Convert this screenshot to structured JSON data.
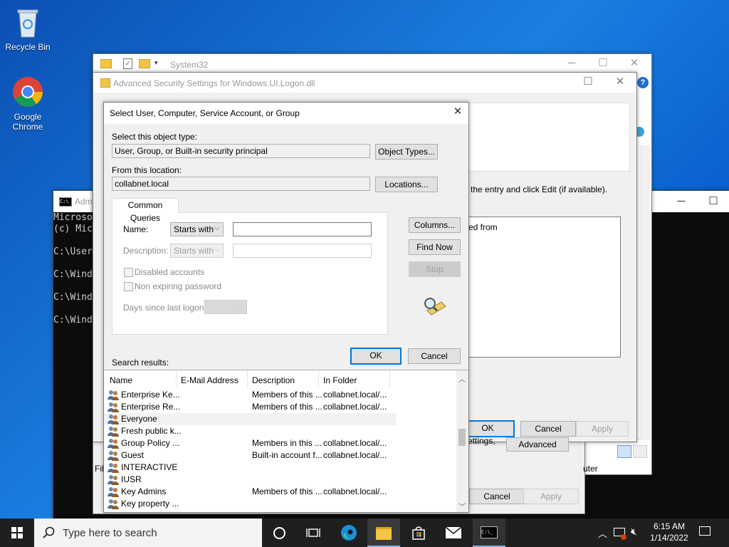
{
  "desktop": {
    "recycle_bin": "Recycle Bin",
    "chrome_line1": "Google",
    "chrome_line2": "Chrome"
  },
  "explorer": {
    "title": "System32"
  },
  "cmd": {
    "title": "Adm",
    "lines": [
      "Microso",
      "(c) Mic",
      "",
      "C:\\User",
      "",
      "C:\\Wind",
      "",
      "C:\\Wind",
      "",
      "C:\\Wind"
    ]
  },
  "adv": {
    "title": "Advanced Security Settings for Windows.UI.Logon.dll",
    "instruction": "the entry and click Edit (if available).",
    "inherited_from": "ed from",
    "settings_fragment": "ettings,",
    "advanced_button": "Advanced",
    "ok": "OK",
    "cancel": "Cancel",
    "apply": "Apply"
  },
  "props": {
    "cancel": "Cancel",
    "apply": "Apply",
    "fil_fragment": "Fil",
    "computer_fragment": "uter"
  },
  "dlg": {
    "title": "Select User, Computer, Service Account, or Group",
    "object_type_label": "Select this object type:",
    "object_type_value": "User, Group, or Built-in security principal",
    "object_types_button": "Object Types...",
    "location_label": "From this location:",
    "location_value": "collabnet.local",
    "locations_button": "Locations...",
    "tab_common": "Common Queries",
    "name_label": "Name:",
    "name_mode": "Starts with",
    "name_value": "",
    "desc_label": "Description:",
    "desc_mode": "Starts with",
    "desc_value": "",
    "disabled_accounts": "Disabled accounts",
    "non_expiring": "Non expiring password",
    "days_since": "Days since last logon:",
    "columns_button": "Columns...",
    "find_now_button": "Find Now",
    "stop_button": "Stop",
    "ok": "OK",
    "cancel": "Cancel",
    "search_results_label": "Search results:",
    "columns": [
      "Name",
      "E-Mail Address",
      "Description",
      "In Folder"
    ],
    "results": [
      {
        "name": "Enterprise Ke...",
        "email": "",
        "desc": "Members of this ...",
        "folder": "collabnet.local/..."
      },
      {
        "name": "Enterprise Re...",
        "email": "",
        "desc": "Members of this ...",
        "folder": "collabnet.local/..."
      },
      {
        "name": "Everyone",
        "email": "",
        "desc": "",
        "folder": ""
      },
      {
        "name": "Fresh public k...",
        "email": "",
        "desc": "",
        "folder": ""
      },
      {
        "name": "Group Policy ...",
        "email": "",
        "desc": "Members in this ...",
        "folder": "collabnet.local/..."
      },
      {
        "name": "Guest",
        "email": "",
        "desc": "Built-in account f...",
        "folder": "collabnet.local/..."
      },
      {
        "name": "INTERACTIVE",
        "email": "",
        "desc": "",
        "folder": ""
      },
      {
        "name": "IUSR",
        "email": "",
        "desc": "",
        "folder": ""
      },
      {
        "name": "Key Admins",
        "email": "",
        "desc": "Members of this ...",
        "folder": "collabnet.local/..."
      },
      {
        "name": "Key property ...",
        "email": "",
        "desc": "",
        "folder": ""
      }
    ]
  },
  "taskbar": {
    "search_placeholder": "Type here to search",
    "time": "6:15 AM",
    "date": "1/14/2022"
  }
}
